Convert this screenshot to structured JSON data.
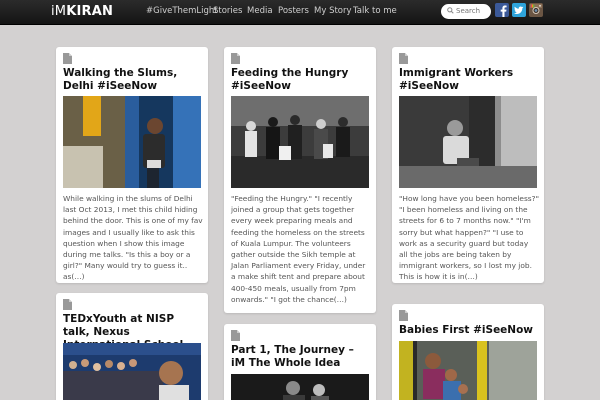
{
  "site": {
    "logo_prefix": "iM",
    "logo_main": "KIRAN"
  },
  "nav": {
    "items": [
      "#GiveThemLight",
      "Stories",
      "Media",
      "Posters",
      "My Story",
      "Talk to me"
    ]
  },
  "search": {
    "placeholder": "Search"
  },
  "social": {
    "facebook": {
      "icon": "facebook-icon",
      "color": "#3b5998"
    },
    "twitter": {
      "icon": "twitter-icon",
      "color": "#2ea4db"
    },
    "instagram": {
      "icon": "instagram-icon",
      "color": "#6b5644"
    }
  },
  "posts": [
    {
      "title": "Walking the Slums, Delhi #iSeeNow",
      "excerpt": "While walking in the slums of Delhi last Oct 2013, I met this child hiding behind the door. This is one of my fav images and I usually like to ask this question when I show this image during me talks. \"Is this a boy or a girl?\" Many would try to guess it.. as(…)"
    },
    {
      "title": "Feeding the Hungry #iSeeNow",
      "excerpt": "\"Feeding the Hungry.\" \"I recently joined a group that gets together every week preparing meals and feeding the homeless on the streets of Kuala Lumpur. The volunteers gather outside the Sikh temple at Jalan Parliament every Friday, under a make shift tent and prepare about 400-450 meals, usually from 7pm onwards.\" \"I got the chance(…)"
    },
    {
      "title": "Immigrant Workers #iSeeNow",
      "excerpt": "\"How long have you been homeless?\" \"I been homeless and living on the streets for 6 to 7 months now.\" \"I'm sorry but what happen?\" \"I use to work as a security guard but today all the jobs are being taken by immigrant workers, so I lost my job. This is how it is in(…)"
    },
    {
      "title": "TEDxYouth at NISP talk, Nexus International School",
      "excerpt": ""
    },
    {
      "title": "Part 1, The Journey – iM The Whole Idea",
      "excerpt": ""
    },
    {
      "title": "Babies First #iSeeNow",
      "excerpt": ""
    }
  ]
}
